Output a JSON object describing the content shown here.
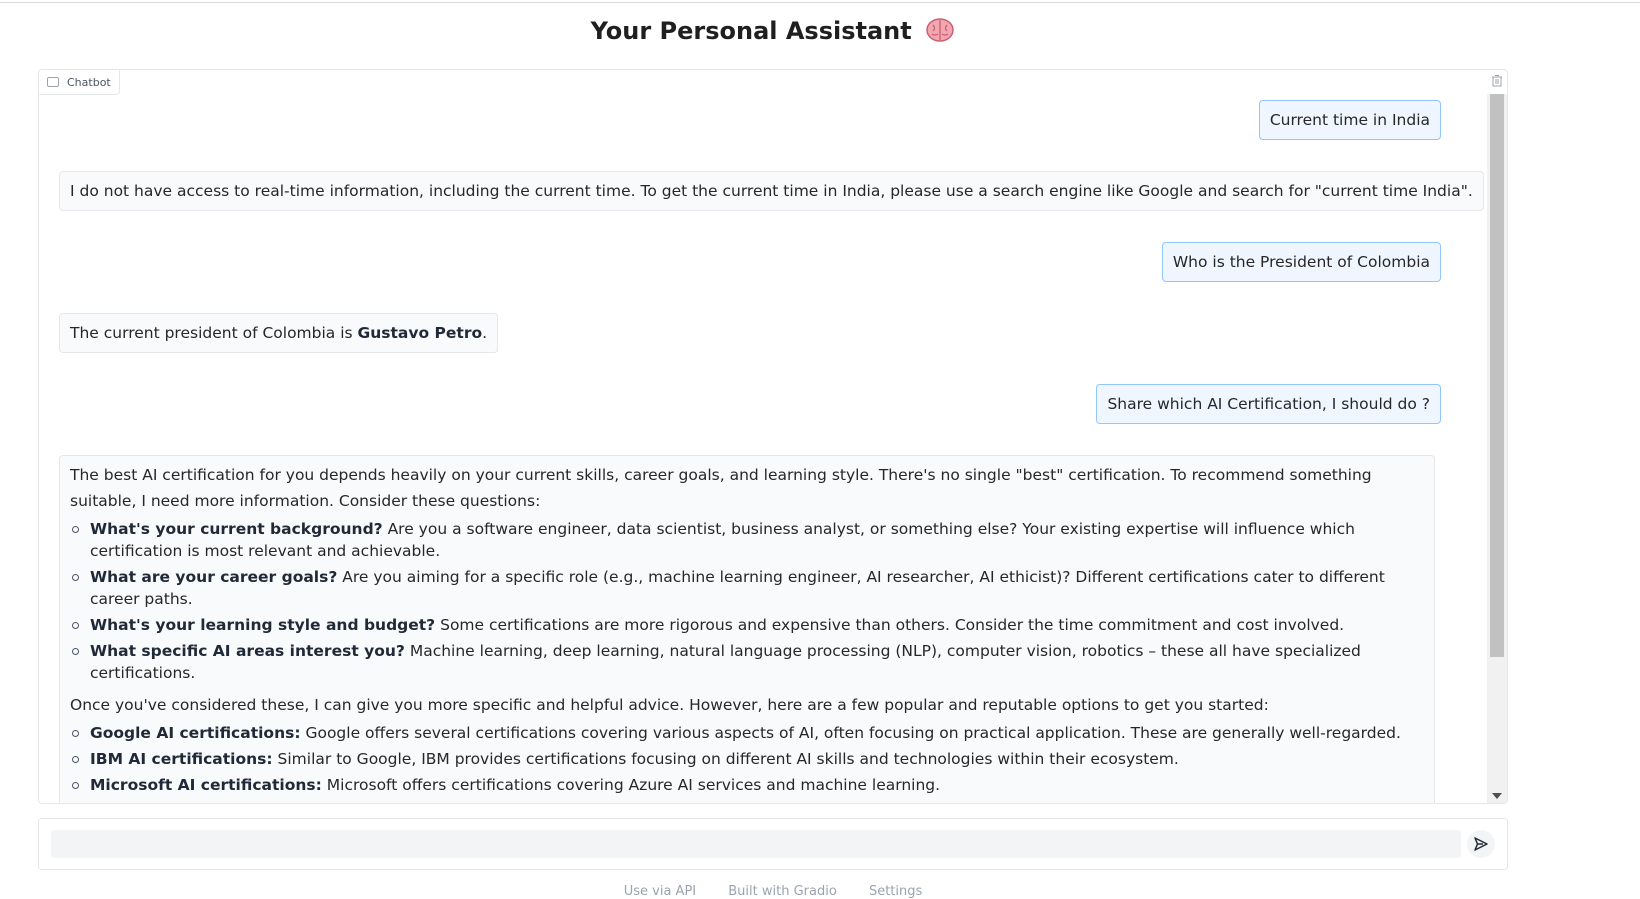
{
  "header": {
    "title": "Your Personal Assistant",
    "title_icon": "brain-icon"
  },
  "chatbot": {
    "label": "Chatbot",
    "label_icon": "chat-icon",
    "clear_icon": "trash-icon",
    "messages": [
      {
        "role": "user",
        "text": "Current time in India"
      },
      {
        "role": "bot",
        "text": "I do not have access to real-time information, including the current time. To get the current time in India, please use a search engine like Google and search for \"current time India\"."
      },
      {
        "role": "user",
        "text": "Who is the President of Colombia"
      },
      {
        "role": "bot",
        "text_prefix": "The current president of Colombia is ",
        "text_bold": "Gustavo Petro",
        "text_suffix": "."
      },
      {
        "role": "user",
        "text": "Share which AI Certification, I should do ?"
      },
      {
        "role": "bot",
        "intro": "The best AI certification for you depends heavily on your current skills, career goals, and learning style. There's no single \"best\" certification. To recommend something suitable, I need more information. Consider these questions:",
        "questions": [
          {
            "bold": "What's your current background?",
            "text": " Are you a software engineer, data scientist, business analyst, or something else? Your existing expertise will influence which certification is most relevant and achievable."
          },
          {
            "bold": "What are your career goals?",
            "text": " Are you aiming for a specific role (e.g., machine learning engineer, AI researcher, AI ethicist)? Different certifications cater to different career paths."
          },
          {
            "bold": "What's your learning style and budget?",
            "text": " Some certifications are more rigorous and expensive than others. Consider the time commitment and cost involved."
          },
          {
            "bold": "What specific AI areas interest you?",
            "text": " Machine learning, deep learning, natural language processing (NLP), computer vision, robotics – these all have specialized certifications."
          }
        ],
        "middle": "Once you've considered these, I can give you more specific and helpful advice. However, here are a few popular and reputable options to get you started:",
        "options": [
          {
            "bold": "Google AI certifications:",
            "text": " Google offers several certifications covering various aspects of AI, often focusing on practical application. These are generally well-regarded."
          },
          {
            "bold": "IBM AI certifications:",
            "text": " Similar to Google, IBM provides certifications focusing on different AI skills and technologies within their ecosystem."
          },
          {
            "bold": "Microsoft AI certifications:",
            "text": " Microsoft offers certifications covering Azure AI services and machine learning."
          }
        ]
      }
    ]
  },
  "input": {
    "placeholder": "",
    "value": "",
    "send_icon": "send-icon"
  },
  "footer": {
    "api": "Use via API",
    "built": "Built with Gradio",
    "settings": "Settings"
  },
  "colors": {
    "user_bubble_bg": "#eff6ff",
    "user_bubble_border": "#93c5fd",
    "bot_bubble_bg": "#f9fafb"
  }
}
